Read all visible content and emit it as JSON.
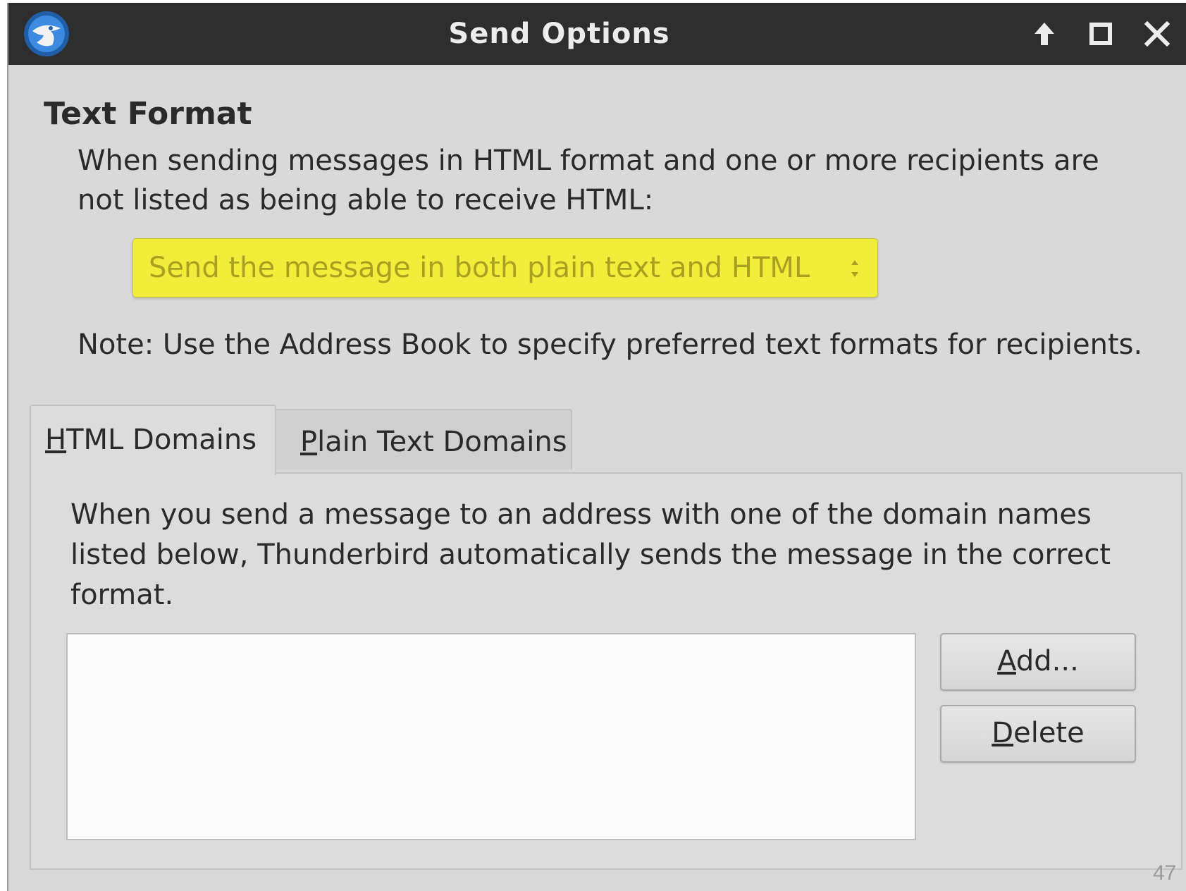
{
  "window": {
    "title": "Send Options"
  },
  "text_format": {
    "heading": "Text Format",
    "intro": "When sending messages in HTML format and one or more recipients are not listed as being able to receive HTML:",
    "format_select": {
      "value": "Send the message in both plain text and HTML"
    },
    "note": "Note: Use the Address Book to specify preferred text formats for recipients."
  },
  "tabs": [
    {
      "label_accel": "H",
      "label_rest": "TML Domains",
      "selected": true
    },
    {
      "label_accel": "P",
      "label_rest": "lain Text Domains",
      "selected": false
    }
  ],
  "domains_panel": {
    "description": "When you send a message to an address with one of the domain names listed below, Thunderbird automatically sends the message in the correct format.",
    "domains": [],
    "add_button": {
      "accel": "A",
      "rest": "dd..."
    },
    "delete_button": {
      "accel": "D",
      "rest": "elete"
    }
  },
  "page_number": "47",
  "colors": {
    "titlebar": "#2e2e2e",
    "dialog_background": "#d9d9d9",
    "select_highlight": "#f0ee3a"
  },
  "icons": {
    "app": "thunderbird-icon",
    "titlebar": [
      "arrow-up-icon",
      "maximize-icon",
      "close-icon"
    ],
    "select": "select-arrows-icon"
  }
}
